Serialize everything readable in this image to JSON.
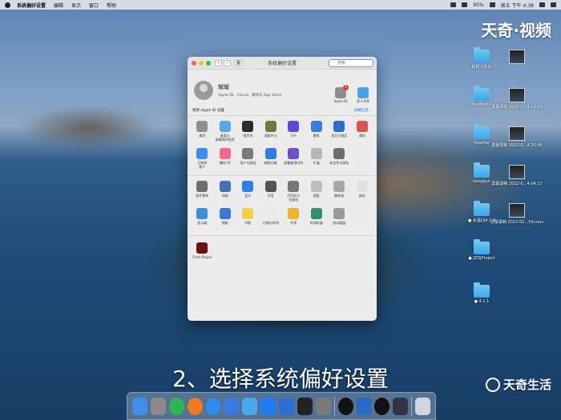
{
  "menubar": {
    "app": "系统偏好设置",
    "items": [
      "编辑",
      "显示",
      "窗口",
      "帮助"
    ],
    "battery": "95%",
    "clock": "周五 下午 4:38"
  },
  "watermark": {
    "top": "天奇·视频",
    "bottom": "天奇生活"
  },
  "subtitle": "2、选择系统偏好设置",
  "desktop": [
    {
      "label": "",
      "kind": "thumb"
    },
    {
      "label": "新建文件夹",
      "kind": "folder"
    },
    {
      "label": "屏幕录制 2022-0...4.12.19",
      "kind": "thumb"
    },
    {
      "label": "Heather 2",
      "kind": "folder"
    },
    {
      "label": "屏幕录制 2022-0...4.20.45",
      "kind": "thumb"
    },
    {
      "label": "Heather",
      "kind": "folder"
    },
    {
      "label": "屏幕录制 2022-0...4.04.17",
      "kind": "thumb"
    },
    {
      "label": "tiangijun",
      "kind": "folder"
    },
    {
      "label": "屏幕录制 2022-01...59.mov",
      "kind": "thumb"
    },
    {
      "label": "● 水晶DJ4.1.9",
      "kind": "folder"
    },
    {
      "label": "● JZDJProject",
      "kind": "folder"
    },
    {
      "label": "● 4.1.1",
      "kind": "folder"
    }
  ],
  "window": {
    "title": "系统偏好设置",
    "search_placeholder": "搜索",
    "user_name": "耀耀",
    "user_sub": "Apple ID、iCloud、媒体与 App Store",
    "apple_id": {
      "label": "Apple ID",
      "badge": "1"
    },
    "family": {
      "label": "家人共享"
    },
    "notice": "更新 Apple ID 设置",
    "notice_link": "详细信息...",
    "row1": [
      {
        "label": "通用",
        "color": "#8a8f98"
      },
      {
        "label": "桌面与\n屏幕保护程序",
        "color": "#5aa9e6"
      },
      {
        "label": "程序坞",
        "color": "#2b2b2b"
      },
      {
        "label": "调度中心",
        "color": "#6b7a3e"
      },
      {
        "label": "Siri",
        "color": "#5b4bd6"
      },
      {
        "label": "聚焦",
        "color": "#3d7bd9"
      },
      {
        "label": "语言与地区",
        "color": "#2f6fcc"
      },
      {
        "label": "通知",
        "color": "#d9534f"
      }
    ],
    "row2": [
      {
        "label": "互联网\n帐户",
        "color": "#3b8eea"
      },
      {
        "label": "触控 ID",
        "color": "#f06b8b"
      },
      {
        "label": "用户与群组",
        "color": "#7a7a7a"
      },
      {
        "label": "辅助功能",
        "color": "#2f7ee6"
      },
      {
        "label": "屏幕使用时间",
        "color": "#6d4fc7"
      },
      {
        "label": "扩展",
        "color": "#b7b7b7"
      },
      {
        "label": "安全性与隐私",
        "color": "#6e6e6e"
      }
    ],
    "row3": [
      {
        "label": "软件更新",
        "color": "#6e6e6e"
      },
      {
        "label": "网络",
        "color": "#4a6fb5"
      },
      {
        "label": "蓝牙",
        "color": "#2f7ee6"
      },
      {
        "label": "声音",
        "color": "#555555"
      },
      {
        "label": "打印机与\n扫描仪",
        "color": "#777777"
      },
      {
        "label": "键盘",
        "color": "#bdbdbd"
      },
      {
        "label": "触控板",
        "color": "#a8a8a8"
      },
      {
        "label": "鼠标",
        "color": "#e0e0e0"
      }
    ],
    "row4": [
      {
        "label": "显示器",
        "color": "#3a8fd9"
      },
      {
        "label": "随航",
        "color": "#3b79d6"
      },
      {
        "label": "节能",
        "color": "#f2d04a"
      },
      {
        "label": "日期与时间",
        "color": "#e9e9e9"
      },
      {
        "label": "共享",
        "color": "#f0b429"
      },
      {
        "label": "时间机器",
        "color": "#2f8f6f"
      },
      {
        "label": "启动磁盘",
        "color": "#9a9a9a"
      }
    ],
    "row5": [
      {
        "label": "Flash Player",
        "color": "#6b1010"
      }
    ]
  },
  "dock": [
    {
      "name": "finder-icon",
      "color": "#3f8fe6"
    },
    {
      "name": "launchpad-icon",
      "color": "#8a8a8a"
    },
    {
      "name": "wechat-icon",
      "color": "#2db84d"
    },
    {
      "name": "firefox-icon",
      "color": "#f07a21"
    },
    {
      "name": "safari-icon",
      "color": "#2e8cf0"
    },
    {
      "name": "xcode-icon",
      "color": "#3a7be0"
    },
    {
      "name": "folder-icon",
      "color": "#4aa8ee"
    },
    {
      "name": "app-store-icon",
      "color": "#1c7df0"
    },
    {
      "name": "upload-icon",
      "color": "#2a6fd1"
    },
    {
      "name": "terminal-icon",
      "color": "#222222"
    },
    {
      "name": "system-preferences-icon",
      "color": "#7a7a7a"
    },
    {
      "name": "qq-icon",
      "color": "#111111"
    },
    {
      "name": "quicktime-icon",
      "color": "#2a69c9"
    },
    {
      "name": "qq-2-icon",
      "color": "#111111"
    },
    {
      "name": "screen-thumb-icon",
      "color": "#334"
    },
    {
      "name": "trash-icon",
      "color": "#cfd6df"
    }
  ]
}
